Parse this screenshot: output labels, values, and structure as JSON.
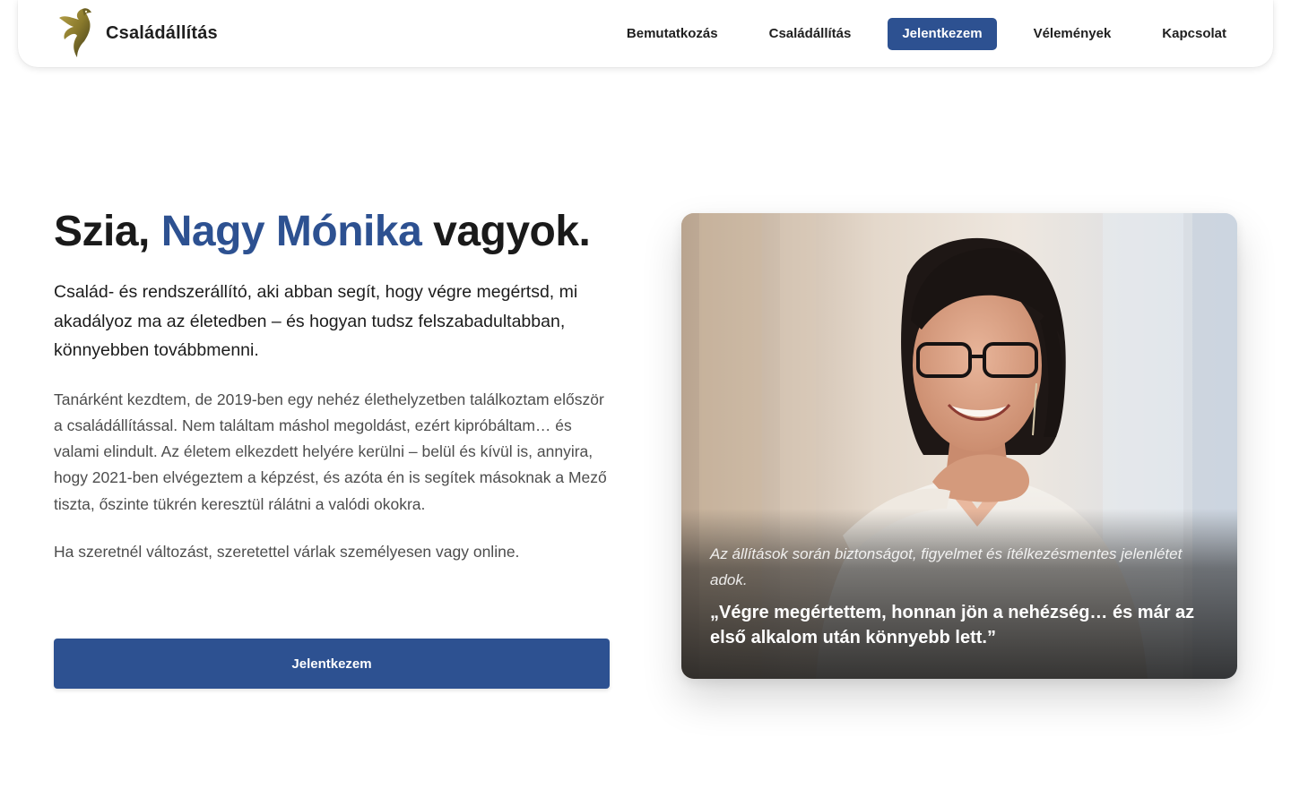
{
  "brand": {
    "name": "Családállítás",
    "logo": "phoenix-logo"
  },
  "nav": {
    "items": [
      {
        "label": "Bemutatkozás",
        "active": false
      },
      {
        "label": "Családállítás",
        "active": false
      },
      {
        "label": "Jelentkezem",
        "active": true
      },
      {
        "label": "Vélemények",
        "active": false
      },
      {
        "label": "Kapcsolat",
        "active": false
      }
    ]
  },
  "hero": {
    "title_prefix": "Szia, ",
    "title_name": "Nagy Mónika",
    "title_suffix": " vagyok.",
    "lead": "Család- és rendszerállító, aki abban segít, hogy végre megértsd, mi akadályoz ma az életedben – és hogyan tudsz felszabadultabban, könnyebben továbbmenni.",
    "body": "Tanárként kezdtem, de 2019-ben egy nehéz élethelyzetben találkoztam először a családállítással. Nem találtam máshol megoldást, ezért kipróbáltam… és valami elindult. Az életem elkezdett helyére kerülni – belül és kívül is, annyira, hogy 2021-ben elvégeztem a képzést, és azóta én is segítek másoknak a Mező tiszta, őszinte tükrén keresztül rálátni a valódi okokra.",
    "body2": "Ha szeretnél változást, szeretettel várlak személyesen vagy online.",
    "cta_label": "Jelentkezem"
  },
  "photo": {
    "alt": "portrait-photo",
    "caption": "Az állítások során biztonságot, figyelmet és ítélkezésmentes jelenlétet adok.",
    "quote": "„Végre megértettem, honnan jön a nehézség… és már az első alkalom után könnyebb lett.”"
  },
  "colors": {
    "accent": "#2d5191",
    "logo_gold": "#8a7a2c",
    "text_dark": "#1a1a1a",
    "text_muted": "#4d4d4d"
  }
}
